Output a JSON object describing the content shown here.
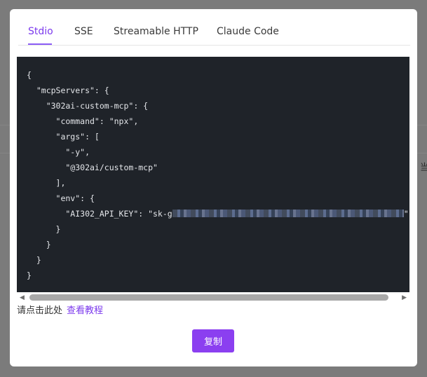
{
  "tabs": [
    "Stdio",
    "SSE",
    "Streamable HTTP",
    "Claude Code"
  ],
  "active_tab": "Stdio",
  "code_lines": [
    "{",
    "  \"mcpServers\": {",
    "    \"302ai-custom-mcp\": {",
    "      \"command\": \"npx\",",
    "      \"args\": [",
    "        \"-y\",",
    "        \"@302ai/custom-mcp\"",
    "      ],",
    "      \"env\": {",
    "        \"AI302_API_KEY\": \"sk-g",
    "      }",
    "    }",
    "  }",
    "}"
  ],
  "hint": {
    "text": "请点击此处",
    "link": "查看教程"
  },
  "copy_button": "复制",
  "background_edge_text": "当",
  "colors": {
    "accent": "#8b3ff0",
    "code_bg": "#1f2329"
  },
  "icons": {
    "scroll_left": "triangle-left",
    "scroll_right": "triangle-right"
  }
}
